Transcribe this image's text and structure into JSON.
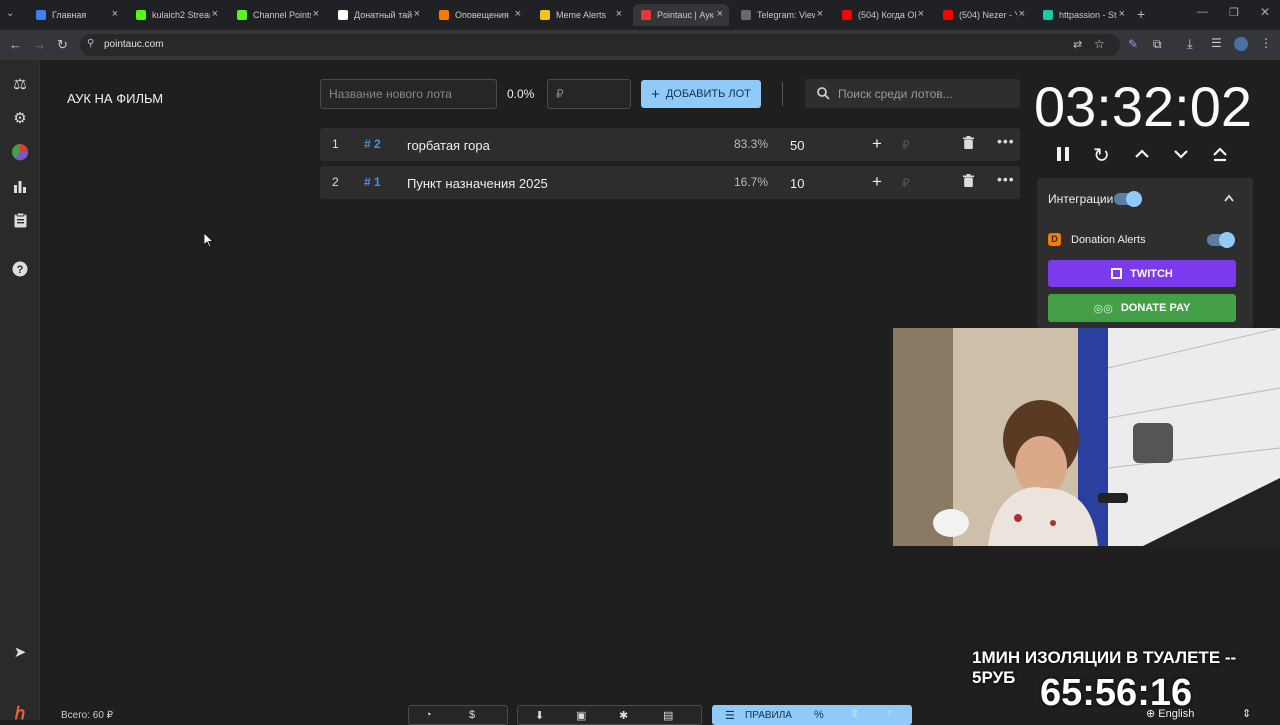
{
  "browser": {
    "tabs": [
      {
        "title": "Главная",
        "color": "#3b82f6"
      },
      {
        "title": "kulaich2 Stream",
        "color": "#53fc18"
      },
      {
        "title": "Channel Points",
        "color": "#53fc18"
      },
      {
        "title": "Донатный тай",
        "color": "#ffffff"
      },
      {
        "title": "Оповещения",
        "color": "#f57c00"
      },
      {
        "title": "Meme Alerts",
        "color": "#f5c518"
      },
      {
        "title": "Pointauc | Аук",
        "color": "#e53935"
      },
      {
        "title": "Telegram: View",
        "color": "#6a6a6a"
      },
      {
        "title": "(504) Когда Ol",
        "color": "#ff0000"
      },
      {
        "title": "(504) Nezer - Y",
        "color": "#ff0000"
      },
      {
        "title": "httpassion - St",
        "color": "#1ec8a5"
      }
    ],
    "url": "pointauc.com"
  },
  "app": {
    "title": "АУК НА ФИЛЬМ",
    "new_lot_placeholder": "Название нового лота",
    "percent": "0.0%",
    "currency_placeholder": "₽",
    "add_lot_label": "ДОБАВИТЬ ЛОТ",
    "search_placeholder": "Поиск среди лотов...",
    "lots": [
      {
        "index": "1",
        "id": "# 2",
        "name": "горбатая гора",
        "percent": "83.3%",
        "amount": "50",
        "currency": "₽"
      },
      {
        "index": "2",
        "id": "# 1",
        "name": "Пункт назначения 2025",
        "percent": "16.7%",
        "amount": "10",
        "currency": "₽"
      }
    ],
    "timer": "03:32:02",
    "integrations": {
      "label": "Интеграции",
      "donation_alerts": "Donation Alerts",
      "twitch": "TWITCH",
      "donatepay": "DONATE PAY"
    },
    "total": "Всего: 60 ₽",
    "bottom": {
      "rules": "ПРАВИЛА",
      "percent_sign": "%"
    },
    "language": "English"
  },
  "stream_overlay": {
    "caption": "1МИН ИЗОЛЯЦИИ В ТУАЛЕТЕ -- 5РУБ",
    "timer": "65:56:16"
  }
}
